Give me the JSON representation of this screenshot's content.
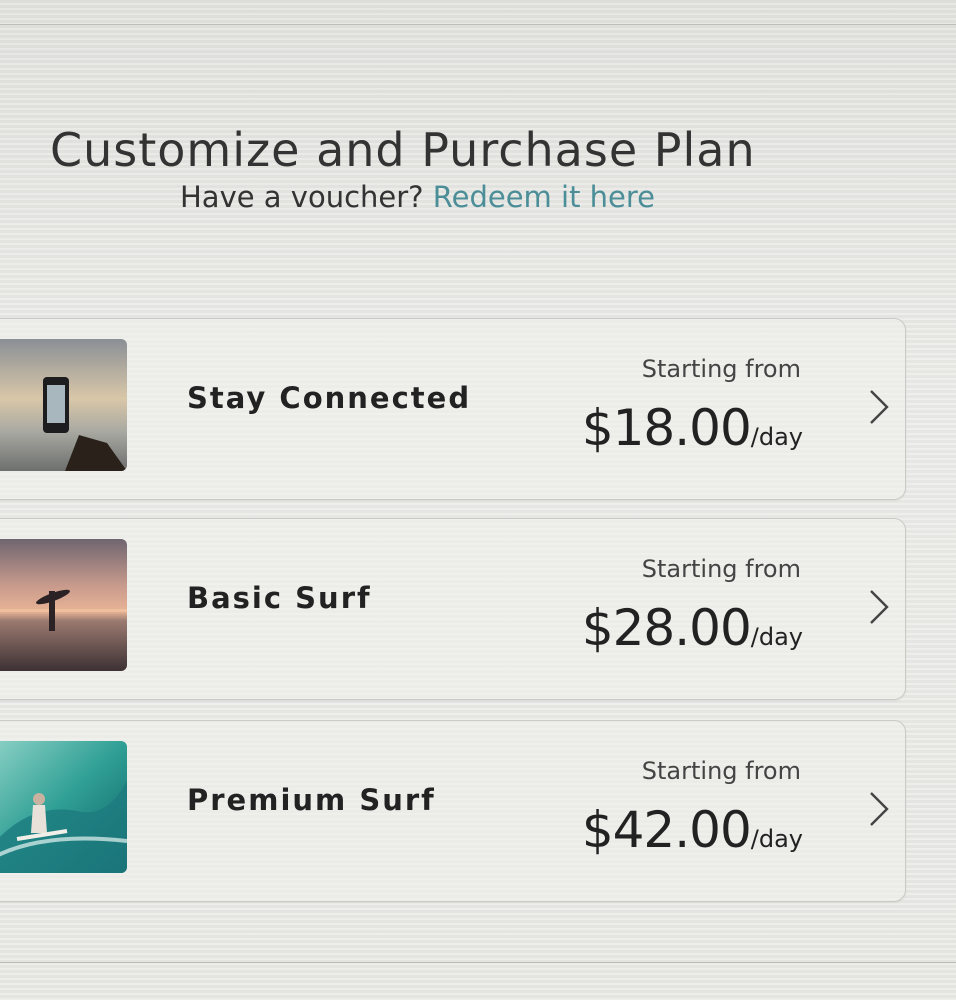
{
  "page": {
    "title": "Customize and Purchase Plan",
    "voucher_prompt": "Have a voucher?",
    "voucher_link": "Redeem it here"
  },
  "plans": [
    {
      "name": "Stay Connected",
      "starting_label": "Starting from",
      "price": "$18.00",
      "unit": "/day",
      "image": "phone-sunset-image"
    },
    {
      "name": "Basic Surf",
      "starting_label": "Starting from",
      "price": "$28.00",
      "unit": "/day",
      "image": "surfer-sunset-image"
    },
    {
      "name": "Premium Surf",
      "starting_label": "Starting from",
      "price": "$42.00",
      "unit": "/day",
      "image": "wave-surfer-image"
    }
  ],
  "icons": {
    "chevron": "chevron-right-icon"
  },
  "colors": {
    "link": "#4b8e98",
    "background": "#e6e6e3",
    "card_border": "#c9c9c5"
  }
}
